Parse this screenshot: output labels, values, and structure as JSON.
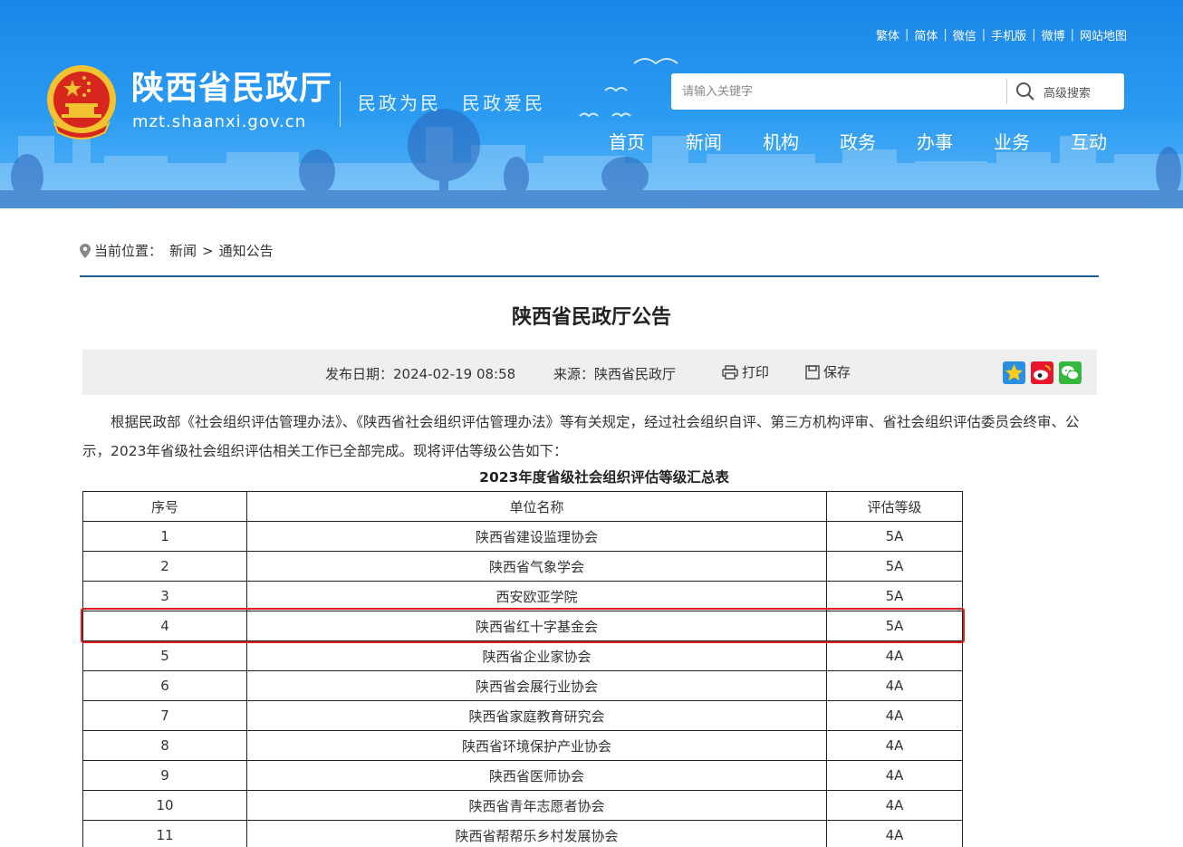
{
  "header": {
    "top_links": [
      "繁体",
      "简体",
      "微信",
      "手机版",
      "微博",
      "网站地图"
    ],
    "site_title": "陕西省民政厅",
    "site_domain": "mzt.shaanxi.gov.cn",
    "slogan": "民政为民　民政爱民",
    "search": {
      "placeholder": "请输入关键字",
      "advanced_label": "高级搜索"
    },
    "nav": [
      "首页",
      "新闻",
      "机构",
      "政务",
      "办事",
      "业务",
      "互动"
    ]
  },
  "breadcrumb": {
    "prefix": "当前位置：",
    "items": [
      "新闻",
      "通知公告"
    ],
    "separator": ">"
  },
  "article": {
    "title": "陕西省民政厅公告",
    "publish_date": "发布日期：2024-02-19 08:58",
    "source": "来源：陕西省民政厅",
    "print_label": "打印",
    "save_label": "保存",
    "paragraph": "根据民政部《社会组织评估管理办法》、《陕西省社会组织评估管理办法》等有关规定，经过社会组织自评、第三方机构评审、省社会组织评估委员会终审、公示，2023年省级社会组织评估相关工作已全部完成。现将评估等级公告如下："
  },
  "table": {
    "title": "2023年度省级社会组织评估等级汇总表",
    "headers": [
      "序号",
      "单位名称",
      "评估等级"
    ],
    "rows": [
      [
        "1",
        "陕西省建设监理协会",
        "5A"
      ],
      [
        "2",
        "陕西省气象学会",
        "5A"
      ],
      [
        "3",
        "西安欧亚学院",
        "5A"
      ],
      [
        "4",
        "陕西省红十字基金会",
        "5A"
      ],
      [
        "5",
        "陕西省企业家协会",
        "4A"
      ],
      [
        "6",
        "陕西省会展行业协会",
        "4A"
      ],
      [
        "7",
        "陕西省家庭教育研究会",
        "4A"
      ],
      [
        "8",
        "陕西省环境保护产业协会",
        "4A"
      ],
      [
        "9",
        "陕西省医师协会",
        "4A"
      ],
      [
        "10",
        "陕西省青年志愿者协会",
        "4A"
      ],
      [
        "11",
        "陕西省帮帮乐乡村发展协会",
        "4A"
      ]
    ],
    "highlighted_row": 4
  },
  "colors": {
    "header_blue": "#1a86e8",
    "rule": "#1e5d8f",
    "highlight": "#e02020"
  },
  "icons": [
    "emblem-icon",
    "search-icon",
    "location-pin-icon",
    "print-icon",
    "save-icon",
    "share-qzone-icon",
    "share-weibo-icon",
    "share-wechat-icon"
  ]
}
